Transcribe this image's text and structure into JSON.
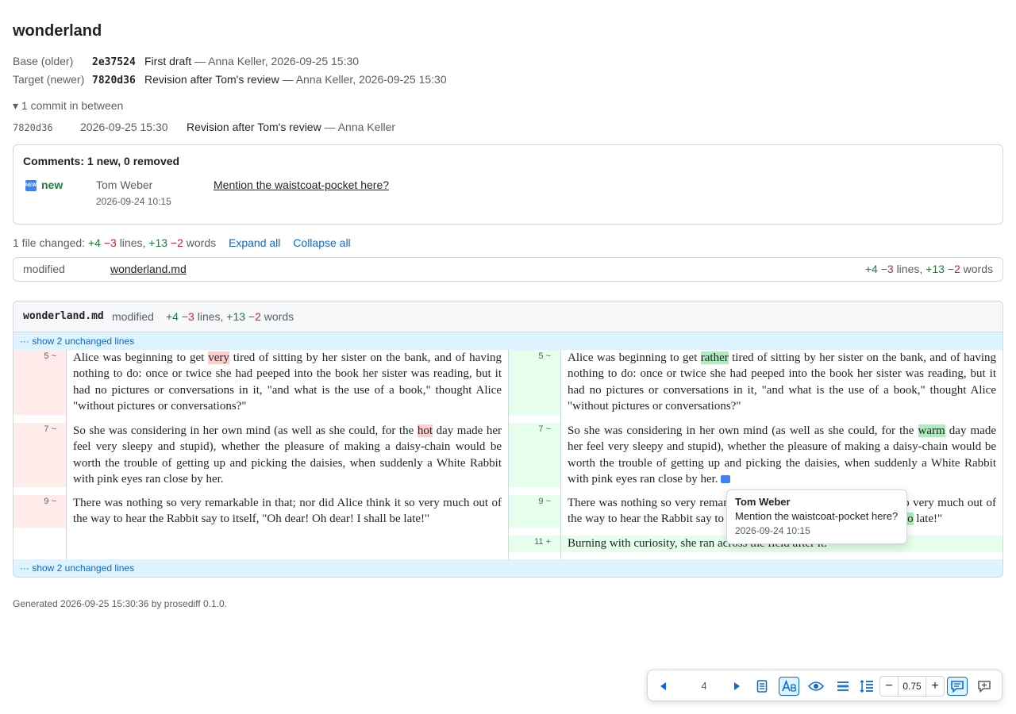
{
  "title": "wonderland",
  "base": {
    "label": "Base (older)",
    "hash": "2e37524",
    "message": "First draft",
    "meta": "— Anna Keller, 2026-09-25 15:30"
  },
  "target": {
    "label": "Target (newer)",
    "hash": "7820d36",
    "message": "Revision after Tom's review",
    "meta": "— Anna Keller, 2026-09-25 15:30"
  },
  "between": {
    "toggle": "▾ 1 commit in between",
    "commit": {
      "hash": "7820d36",
      "date": "2026-09-25 15:30",
      "message": "Revision after Tom's review",
      "author": "— Anna Keller"
    }
  },
  "comments": {
    "title": "Comments: 1 new, 0 removed",
    "items": [
      {
        "status": "new",
        "author": "Tom Weber",
        "date": "2026-09-24 10:15",
        "text": "Mention the waistcoat-pocket here?"
      }
    ]
  },
  "summary": {
    "prefix": "1 file changed:",
    "lines_add": "+4",
    "lines_del": "−3",
    "lines_word": "lines,",
    "words_add": "+13",
    "words_del": "−2",
    "words_word": "words",
    "expand_all": "Expand all",
    "collapse_all": "Collapse all"
  },
  "file": {
    "state": "modified",
    "name": "wonderland.md"
  },
  "diff": {
    "file_name": "wonderland.md",
    "state": "modified",
    "unchanged_label": "··· show 2 unchanged lines",
    "left": [
      {
        "num": "5 ~",
        "pre": "Alice was beginning to get ",
        "hl": "very",
        "post": " tired of sitting by her sister on the bank, and of having nothing to do: once or twice she had peeped into the book her sister was reading, but it had no pictures or conversations in it, \"and what is the use of a book,\" thought Alice \"without pictures or conversations?\""
      },
      {
        "num": "7 ~",
        "pre": "So she was considering in her own mind (as well as she could, for the ",
        "hl": "hot",
        "post": " day made her feel very sleepy and stupid), whether the pleasure of making a daisy-chain would be worth the trouble of getting up and picking the daisies, when suddenly a White Rabbit with pink eyes ran close by her."
      },
      {
        "num": "9 ~",
        "pre": "There was nothing so very remarkable in that; nor did Alice think it so very much out of the way to hear the Rabbit say to itself, \"Oh dear! Oh dear! I shall be late!\"",
        "hl": "",
        "post": ""
      }
    ],
    "right": [
      {
        "num": "5 ~",
        "pre": "Alice was beginning to get ",
        "hl": "rather",
        "post": " tired of sitting by her sister on the bank, and of having nothing to do: once or twice she had peeped into the book her sister was reading, but it had no pictures or conversations in it, \"and what is the use of a book,\" thought Alice \"without pictures or conversations?\""
      },
      {
        "num": "7 ~",
        "pre": "So she was considering in her own mind (as well as she could, for the ",
        "hl": "warm",
        "post": " day made her feel very sleepy and stupid), whether the pleasure of making a daisy-chain would be worth the trouble of getting up and picking the daisies, when suddenly a White Rabbit with pink eyes ran close by her."
      },
      {
        "num": "9 ~",
        "pre": "There was nothing so very remarkable in that; nor did Alice think it so very much out of the way to hear the Rabbit say to itself, \"Oh dear! Oh dear! I shall be ",
        "hl": "too",
        "post": " late!\""
      },
      {
        "num": "11 +",
        "pre": "Burning with curiosity, she ran across the field after it.",
        "hl": "",
        "post": ""
      }
    ]
  },
  "tooltip": {
    "author": "Tom Weber",
    "text": "Mention the waistcoat-pocket here?",
    "date": "2026-09-24 10:15"
  },
  "footer": "Generated 2026-09-25 15:30:36 by prosediff 0.1.0.",
  "toolbar": {
    "page": "4",
    "zoom": "0.75",
    "zoom_minus": "−",
    "zoom_plus": "+"
  },
  "icons": [
    "prev-arrow-icon",
    "next-arrow-icon",
    "document-icon",
    "text-case-icon",
    "eye-icon",
    "align-icon",
    "line-height-icon",
    "comment-icon",
    "comment-add-icon"
  ],
  "colors": {
    "add": "#1a7f37",
    "del": "#cf222e",
    "link": "#0969da",
    "add_bg": "#e6ffec",
    "del_bg": "#ffebe9"
  }
}
